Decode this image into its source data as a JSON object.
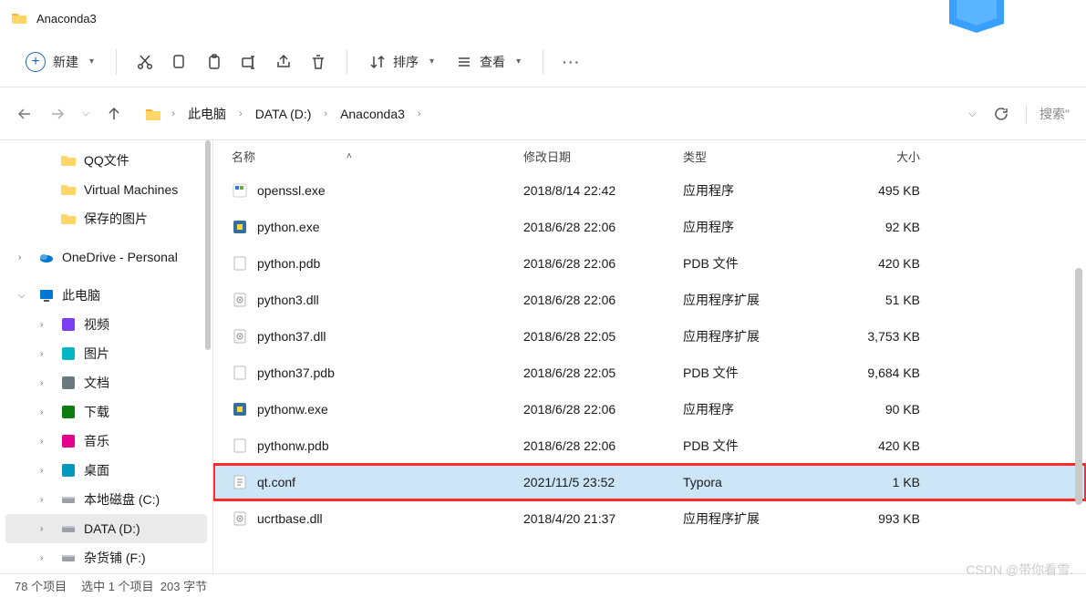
{
  "window": {
    "title": "Anaconda3"
  },
  "toolbar": {
    "new_label": "新建",
    "sort_label": "排序",
    "view_label": "查看"
  },
  "breadcrumb": {
    "items": [
      "此电脑",
      "DATA (D:)",
      "Anaconda3"
    ]
  },
  "search": {
    "placeholder": "搜索\""
  },
  "sidebar": {
    "items": [
      {
        "label": "QQ文件",
        "icon": "folder",
        "indent": true
      },
      {
        "label": "Virtual Machines",
        "icon": "folder",
        "indent": true
      },
      {
        "label": "保存的图片",
        "icon": "folder",
        "indent": true
      },
      {
        "label": "OneDrive - Personal",
        "icon": "onedrive",
        "exp": ">"
      },
      {
        "label": "此电脑",
        "icon": "pc",
        "exp": "v"
      },
      {
        "label": "视频",
        "icon": "video",
        "exp": ">",
        "indent": true
      },
      {
        "label": "图片",
        "icon": "pictures",
        "exp": ">",
        "indent": true
      },
      {
        "label": "文档",
        "icon": "docs",
        "exp": ">",
        "indent": true
      },
      {
        "label": "下载",
        "icon": "downloads",
        "exp": ">",
        "indent": true
      },
      {
        "label": "音乐",
        "icon": "music",
        "exp": ">",
        "indent": true
      },
      {
        "label": "桌面",
        "icon": "desktop",
        "exp": ">",
        "indent": true
      },
      {
        "label": "本地磁盘 (C:)",
        "icon": "disk",
        "exp": ">",
        "indent": true
      },
      {
        "label": "DATA (D:)",
        "icon": "disk",
        "exp": ">",
        "indent": true,
        "selected": true
      },
      {
        "label": "杂货铺 (F:)",
        "icon": "disk",
        "exp": ">",
        "indent": true
      }
    ]
  },
  "columns": {
    "name": "名称",
    "date": "修改日期",
    "type": "类型",
    "size": "大小"
  },
  "files": [
    {
      "name": "openssl.exe",
      "date": "2018/8/14 22:42",
      "type": "应用程序",
      "size": "495 KB",
      "icon": "exe"
    },
    {
      "name": "python.exe",
      "date": "2018/6/28 22:06",
      "type": "应用程序",
      "size": "92 KB",
      "icon": "pyexe"
    },
    {
      "name": "python.pdb",
      "date": "2018/6/28 22:06",
      "type": "PDB 文件",
      "size": "420 KB",
      "icon": "file"
    },
    {
      "name": "python3.dll",
      "date": "2018/6/28 22:06",
      "type": "应用程序扩展",
      "size": "51 KB",
      "icon": "dll"
    },
    {
      "name": "python37.dll",
      "date": "2018/6/28 22:05",
      "type": "应用程序扩展",
      "size": "3,753 KB",
      "icon": "dll"
    },
    {
      "name": "python37.pdb",
      "date": "2018/6/28 22:05",
      "type": "PDB 文件",
      "size": "9,684 KB",
      "icon": "file"
    },
    {
      "name": "pythonw.exe",
      "date": "2018/6/28 22:06",
      "type": "应用程序",
      "size": "90 KB",
      "icon": "pyexe"
    },
    {
      "name": "pythonw.pdb",
      "date": "2018/6/28 22:06",
      "type": "PDB 文件",
      "size": "420 KB",
      "icon": "file"
    },
    {
      "name": "qt.conf",
      "date": "2021/11/5 23:52",
      "type": "Typora",
      "size": "1 KB",
      "icon": "conf",
      "selected": true,
      "highlight": true
    },
    {
      "name": "ucrtbase.dll",
      "date": "2018/4/20 21:37",
      "type": "应用程序扩展",
      "size": "993 KB",
      "icon": "dll"
    }
  ],
  "status": {
    "count": "78 个项目",
    "selection": "选中 1 个项目",
    "bytes": "203 字节"
  },
  "watermark": "CSDN @带你看雪."
}
